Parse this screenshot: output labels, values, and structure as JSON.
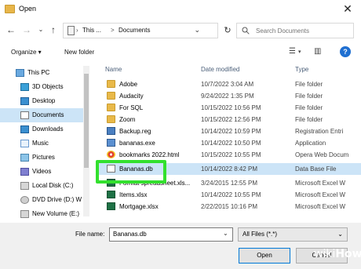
{
  "window": {
    "title": "Open"
  },
  "address": {
    "segments": [
      "This ...",
      "Documents"
    ],
    "separator": ">"
  },
  "search": {
    "placeholder": "Search Documents"
  },
  "toolbar": {
    "organize": "Organize ▾",
    "new_folder": "New folder"
  },
  "nav": {
    "items": [
      {
        "label": "This PC",
        "icon": "pc-icon"
      },
      {
        "label": "3D Objects",
        "icon": "cube-icon"
      },
      {
        "label": "Desktop",
        "icon": "desktop-icon"
      },
      {
        "label": "Documents",
        "icon": "document-folder-icon",
        "selected": true
      },
      {
        "label": "Downloads",
        "icon": "download-icon"
      },
      {
        "label": "Music",
        "icon": "music-icon"
      },
      {
        "label": "Pictures",
        "icon": "pictures-icon"
      },
      {
        "label": "Videos",
        "icon": "videos-icon"
      },
      {
        "label": "Local Disk (C:)",
        "icon": "drive-icon"
      },
      {
        "label": "DVD Drive (D:) W",
        "icon": "dvd-icon"
      },
      {
        "label": "New Volume (E:)",
        "icon": "drive-icon"
      }
    ]
  },
  "list": {
    "columns": [
      "Name",
      "Date modified",
      "Type"
    ],
    "rows": [
      {
        "name": "Adobe",
        "date": "10/7/2022 3:04 AM",
        "type": "File folder",
        "icon": "folder-icon"
      },
      {
        "name": "Audacity",
        "date": "9/24/2022 1:35 PM",
        "type": "File folder",
        "icon": "folder-icon"
      },
      {
        "name": "For SQL",
        "date": "10/15/2022 10:56 PM",
        "type": "File folder",
        "icon": "folder-icon"
      },
      {
        "name": "Zoom",
        "date": "10/15/2022 12:56 PM",
        "type": "File folder",
        "icon": "folder-icon"
      },
      {
        "name": "Backup.reg",
        "date": "10/14/2022 10:59 PM",
        "type": "Registration Entri",
        "icon": "registry-icon"
      },
      {
        "name": "bananas.exe",
        "date": "10/14/2022 10:50 PM",
        "type": "Application",
        "icon": "exe-icon"
      },
      {
        "name": "bookmarks 2022.html",
        "date": "10/15/2022 10:55 PM",
        "type": "Opera Web Docum",
        "icon": "html-icon"
      },
      {
        "name": "Bananas.db",
        "date": "10/14/2022 8:42 PM",
        "type": "Data Base File",
        "icon": "document-icon",
        "selected": true
      },
      {
        "name": "Format spreadsheet.xls...",
        "date": "3/24/2015 12:55 PM",
        "type": "Microsoft Excel W",
        "icon": "excel-icon"
      },
      {
        "name": "Items.xlsx",
        "date": "10/14/2022 10:55 PM",
        "type": "Microsoft Excel W",
        "icon": "excel-icon"
      },
      {
        "name": "Mortgage.xlsx",
        "date": "2/22/2015 10:16 PM",
        "type": "Microsoft Excel W",
        "icon": "excel-icon"
      }
    ]
  },
  "footer": {
    "file_name_label": "File name:",
    "file_name_value": "Bananas.db",
    "filter_value": "All Files (*.*)",
    "open_label": "Open",
    "cancel_label": "Cancel"
  },
  "watermark": {
    "wiki": "wiki",
    "how": "How"
  },
  "colors": {
    "selection": "#cce4f7",
    "highlight_box": "#33e02e",
    "accent": "#0078d7"
  }
}
